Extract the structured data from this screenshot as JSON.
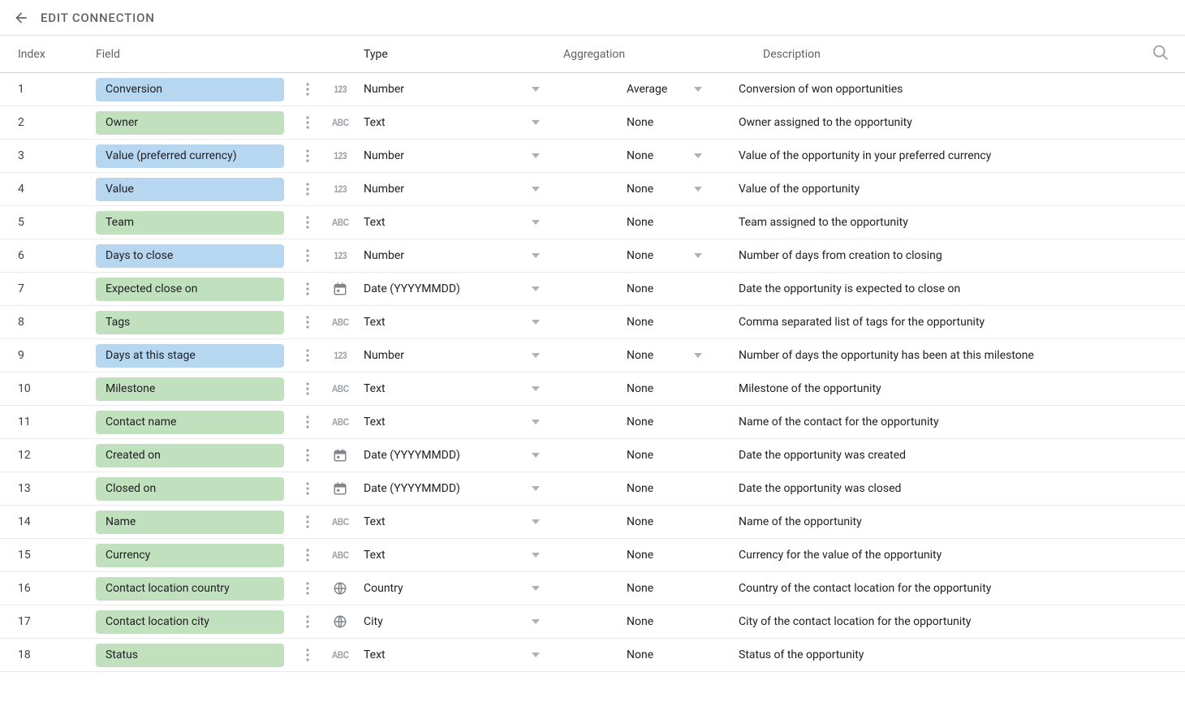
{
  "title": "EDIT CONNECTION",
  "headers": {
    "index": "Index",
    "field": "Field",
    "type": "Type",
    "aggregation": "Aggregation",
    "description": "Description"
  },
  "rows": [
    {
      "index": "1",
      "field": "Conversion",
      "kind": "metric",
      "typeIcon": "num",
      "type": "Number",
      "aggregation": "Average",
      "aggDd": true,
      "description": "Conversion of won opportunities"
    },
    {
      "index": "2",
      "field": "Owner",
      "kind": "dimension",
      "typeIcon": "abc",
      "type": "Text",
      "aggregation": "None",
      "aggDd": false,
      "description": "Owner assigned to the opportunity"
    },
    {
      "index": "3",
      "field": "Value (preferred currency)",
      "kind": "metric",
      "typeIcon": "num",
      "type": "Number",
      "aggregation": "None",
      "aggDd": true,
      "description": "Value of the opportunity in your preferred currency"
    },
    {
      "index": "4",
      "field": "Value",
      "kind": "metric",
      "typeIcon": "num",
      "type": "Number",
      "aggregation": "None",
      "aggDd": true,
      "description": "Value of the opportunity"
    },
    {
      "index": "5",
      "field": "Team",
      "kind": "dimension",
      "typeIcon": "abc",
      "type": "Text",
      "aggregation": "None",
      "aggDd": false,
      "description": "Team assigned to the opportunity"
    },
    {
      "index": "6",
      "field": "Days to close",
      "kind": "metric",
      "typeIcon": "num",
      "type": "Number",
      "aggregation": "None",
      "aggDd": true,
      "description": "Number of days from creation to closing"
    },
    {
      "index": "7",
      "field": "Expected close on",
      "kind": "dimension",
      "typeIcon": "date",
      "type": "Date (YYYYMMDD)",
      "aggregation": "None",
      "aggDd": false,
      "description": "Date the opportunity is expected to close on"
    },
    {
      "index": "8",
      "field": "Tags",
      "kind": "dimension",
      "typeIcon": "abc",
      "type": "Text",
      "aggregation": "None",
      "aggDd": false,
      "description": "Comma separated list of tags for the opportunity"
    },
    {
      "index": "9",
      "field": "Days at this stage",
      "kind": "metric",
      "typeIcon": "num",
      "type": "Number",
      "aggregation": "None",
      "aggDd": true,
      "description": "Number of days the opportunity has been at this milestone"
    },
    {
      "index": "10",
      "field": "Milestone",
      "kind": "dimension",
      "typeIcon": "abc",
      "type": "Text",
      "aggregation": "None",
      "aggDd": false,
      "description": "Milestone of the opportunity"
    },
    {
      "index": "11",
      "field": "Contact name",
      "kind": "dimension",
      "typeIcon": "abc",
      "type": "Text",
      "aggregation": "None",
      "aggDd": false,
      "description": "Name of the contact for the opportunity"
    },
    {
      "index": "12",
      "field": "Created on",
      "kind": "dimension",
      "typeIcon": "date",
      "type": "Date (YYYYMMDD)",
      "aggregation": "None",
      "aggDd": false,
      "description": "Date the opportunity was created"
    },
    {
      "index": "13",
      "field": "Closed on",
      "kind": "dimension",
      "typeIcon": "date",
      "type": "Date (YYYYMMDD)",
      "aggregation": "None",
      "aggDd": false,
      "description": "Date the opportunity was closed"
    },
    {
      "index": "14",
      "field": "Name",
      "kind": "dimension",
      "typeIcon": "abc",
      "type": "Text",
      "aggregation": "None",
      "aggDd": false,
      "description": "Name of the opportunity"
    },
    {
      "index": "15",
      "field": "Currency",
      "kind": "dimension",
      "typeIcon": "abc",
      "type": "Text",
      "aggregation": "None",
      "aggDd": false,
      "description": "Currency for the value of the opportunity"
    },
    {
      "index": "16",
      "field": "Contact location country",
      "kind": "dimension",
      "typeIcon": "globe",
      "type": "Country",
      "aggregation": "None",
      "aggDd": false,
      "description": "Country of the contact location for the opportunity"
    },
    {
      "index": "17",
      "field": "Contact location city",
      "kind": "dimension",
      "typeIcon": "globe",
      "type": "City",
      "aggregation": "None",
      "aggDd": false,
      "description": "City of the contact location for the opportunity"
    },
    {
      "index": "18",
      "field": "Status",
      "kind": "dimension",
      "typeIcon": "abc",
      "type": "Text",
      "aggregation": "None",
      "aggDd": false,
      "description": "Status of the opportunity"
    }
  ]
}
